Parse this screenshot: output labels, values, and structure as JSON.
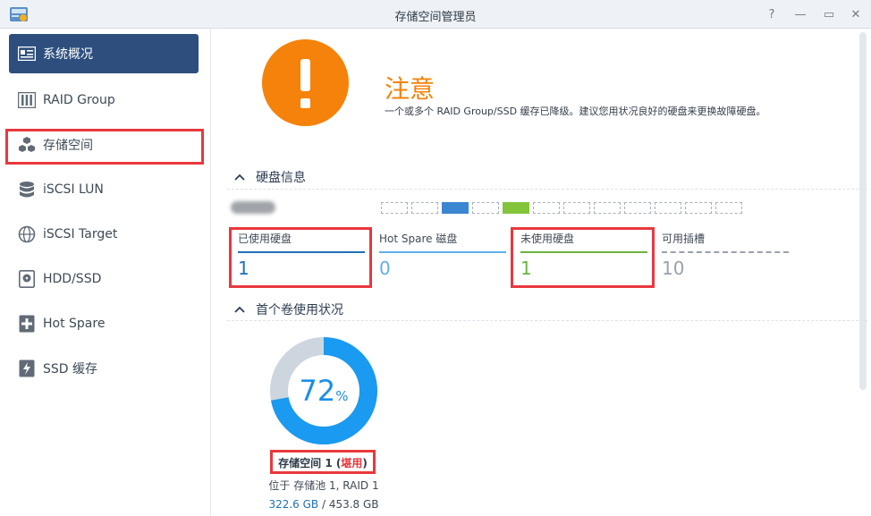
{
  "window": {
    "title": "存储空间管理员",
    "help_glyph": "?",
    "min_glyph": "—",
    "max_glyph": "▭",
    "close_glyph": "✕"
  },
  "sidebar": {
    "items": [
      {
        "label": "系统概况",
        "icon": "overview-icon",
        "active": true
      },
      {
        "label": "RAID Group",
        "icon": "raid-group-icon"
      },
      {
        "label": "存储空间",
        "icon": "volume-cubes-icon"
      },
      {
        "label": "iSCSI LUN",
        "icon": "iscsi-lun-icon"
      },
      {
        "label": "iSCSI Target",
        "icon": "iscsi-target-icon"
      },
      {
        "label": "HDD/SSD",
        "icon": "hdd-icon"
      },
      {
        "label": "Hot Spare",
        "icon": "hot-spare-icon"
      },
      {
        "label": "SSD 缓存",
        "icon": "ssd-cache-icon"
      }
    ]
  },
  "status": {
    "title": "注意",
    "description": "一个或多个 RAID Group/SSD 缓存已降级。建议您用状况良好的硬盘来更换故障硬盘。",
    "icon": "warning-icon",
    "color": "#f5820a"
  },
  "disk_info": {
    "heading": "硬盘信息",
    "slots": [
      "empty",
      "empty",
      "used",
      "empty",
      "unused",
      "empty",
      "empty",
      "empty",
      "empty",
      "empty",
      "empty",
      "empty"
    ],
    "stats": [
      {
        "label": "已使用硬盘",
        "value": "1",
        "color": "#1f6fb8"
      },
      {
        "label": "Hot Spare 磁盘",
        "value": "0",
        "color": "#5fb0ea"
      },
      {
        "label": "未使用硬盘",
        "value": "1",
        "color": "#6db33f"
      },
      {
        "label": "可用插槽",
        "value": "10",
        "color": "#9aa2aa"
      }
    ]
  },
  "volume_usage": {
    "heading": "首个卷使用状况",
    "percent": 72,
    "percent_number": "72",
    "percent_unit": "%",
    "name": "存储空间 1",
    "status_open": " (",
    "status": "堪用",
    "status_close": ")",
    "location": "位于 存储池 1, RAID 1",
    "used": "322.6 GB",
    "separator": " / ",
    "total": "453.8 GB",
    "used_color": "#1a9af0",
    "free_color": "#cdd6df"
  }
}
